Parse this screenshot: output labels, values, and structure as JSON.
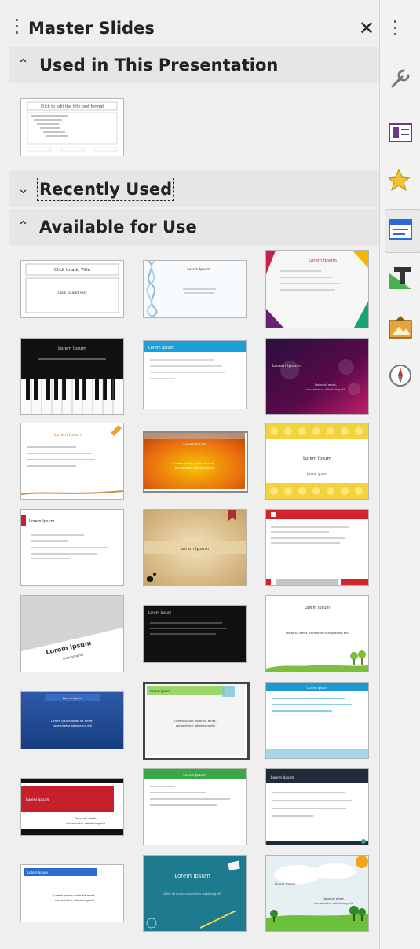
{
  "panel": {
    "title": "Master Slides",
    "close_glyph": "✕"
  },
  "sections": {
    "used": {
      "label": "Used in This Presentation",
      "expanded": true
    },
    "recent": {
      "label": "Recently Used",
      "expanded": false
    },
    "available": {
      "label": "Available for Use",
      "expanded": true
    }
  },
  "thumbs": {
    "used_default_title": "Click to edit the title text format",
    "default_title": "Click to add Title",
    "default_text": "Click to add Text",
    "lorem": "Lorem Ipsum",
    "lorem_lower": "Lorem ipsum",
    "dolor": "Dolor sit amet, consectetur adipiscing elit"
  },
  "sidebar": {
    "icons": [
      "properties-icon",
      "slide-transition-icon",
      "animation-icon",
      "master-slides-icon",
      "styles-icon",
      "gallery-icon",
      "navigator-icon"
    ]
  }
}
